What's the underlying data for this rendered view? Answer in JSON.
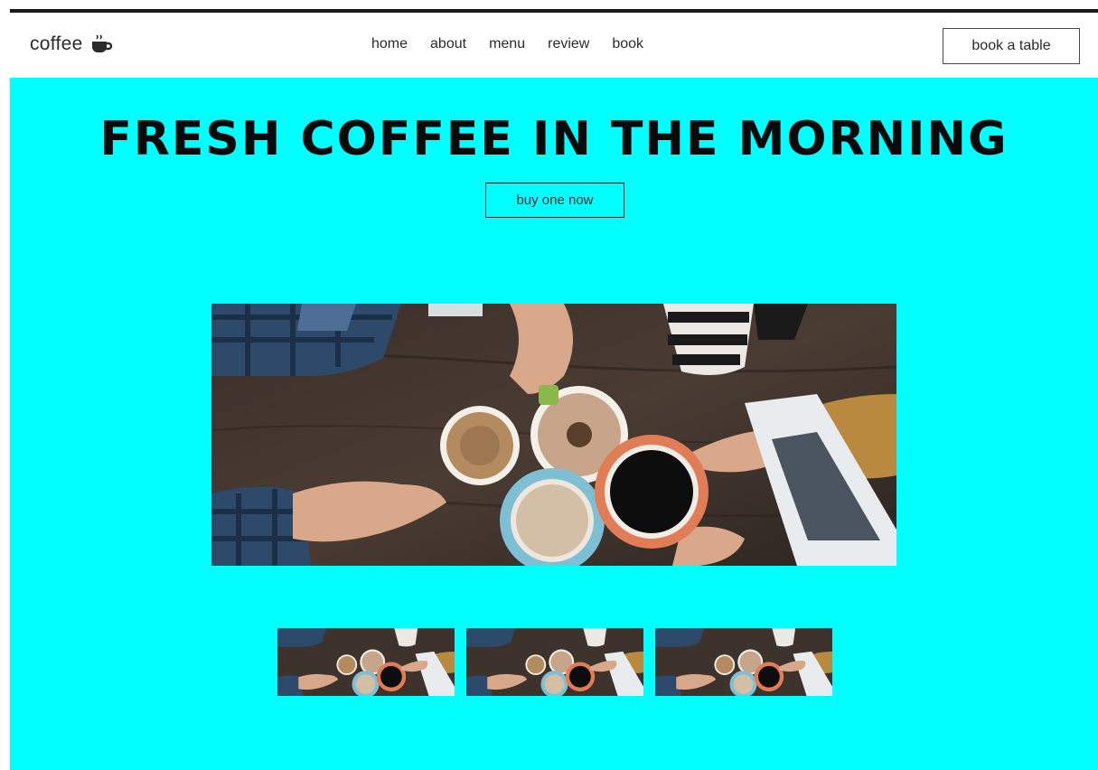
{
  "brand": {
    "name": "coffee",
    "icon": "coffee-cup-icon"
  },
  "nav": {
    "items": [
      "home",
      "about",
      "menu",
      "review",
      "book"
    ]
  },
  "header": {
    "book_label": "book a table"
  },
  "hero": {
    "title": "FRESH COFFEE IN THE MORNING",
    "cta_label": "buy one now",
    "background_color": "#00ffff"
  },
  "gallery": {
    "thumbnail_count": 3
  }
}
